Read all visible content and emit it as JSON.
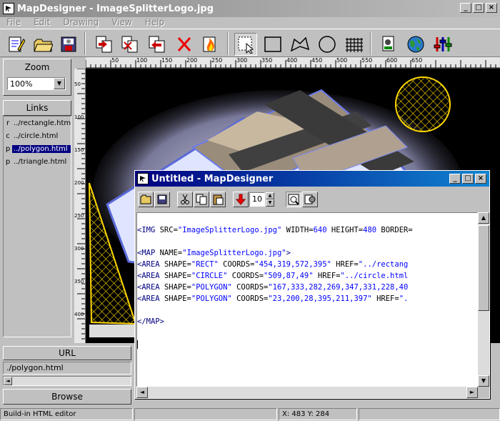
{
  "app": {
    "title": "MapDesigner - ImageSplitterLogo.jpg"
  },
  "menu": [
    "File",
    "Edit",
    "Drawing",
    "View",
    "Help"
  ],
  "zoom": {
    "label": "Zoom",
    "value": "100%"
  },
  "links": {
    "label": "Links",
    "items": [
      {
        "key": "r",
        "value": "../rectangle.html",
        "selected": false
      },
      {
        "key": "c",
        "value": "../circle.html",
        "selected": false
      },
      {
        "key": "p",
        "value": "../polygon.html",
        "selected": true
      },
      {
        "key": "p",
        "value": "../triangle.html",
        "selected": false
      }
    ]
  },
  "ruler": {
    "h": [
      "50",
      "100",
      "150",
      "200",
      "250",
      "300",
      "350",
      "400",
      "450",
      "500",
      "550",
      "600",
      "650"
    ],
    "v": [
      "50",
      "100",
      "150",
      "200",
      "250",
      "300",
      "350",
      "400"
    ]
  },
  "url": {
    "label": "URL",
    "value": "./polygon.html",
    "browse": "Browse"
  },
  "status": {
    "left": "Build-in HTML editor",
    "coords": "X: 483 Y: 284"
  },
  "editor_window": {
    "title": "Untitled - MapDesigner",
    "spin_value": "10"
  },
  "code": [
    "",
    "<IMG SRC=\"ImageSplitterLogo.jpg\" WIDTH=640 HEIGHT=480 BORDER=",
    "",
    "<MAP NAME=\"ImageSplitterLogo.jpg\">",
    "<AREA SHAPE=\"RECT\" COORDS=\"454,319,572,395\" HREF=\"../rectang",
    "<AREA SHAPE=\"CIRCLE\" COORDS=\"509,87,49\" HREF=\"../circle.html",
    "<AREA SHAPE=\"POLYGON\" COORDS=\"167,333,282,269,347,331,228,40",
    "<AREA SHAPE=\"POLYGON\" COORDS=\"23,200,28,395,211,397\" HREF=\".",
    "",
    "</MAP>",
    "",
    ""
  ],
  "colors": {
    "title_active": "#000080",
    "selection": "#000080",
    "outline": "#ffd800"
  }
}
